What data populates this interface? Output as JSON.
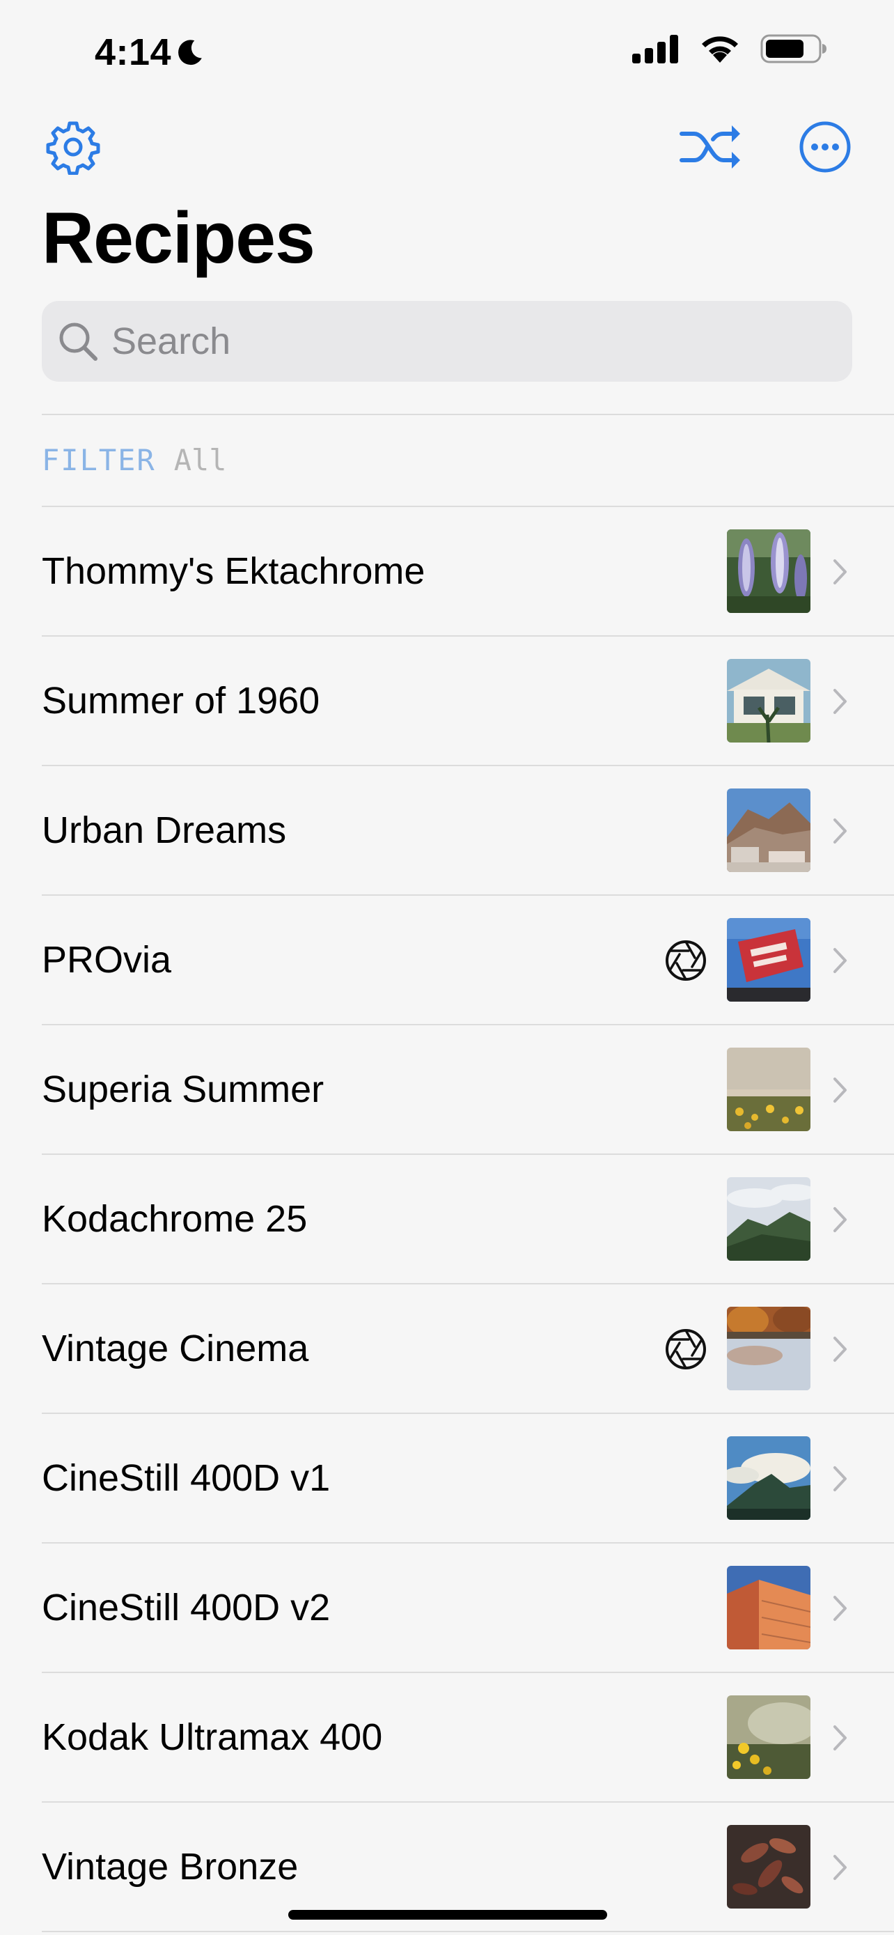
{
  "status_bar": {
    "time": "4:14",
    "icons": [
      "moon-icon",
      "cellular-signal-icon",
      "wifi-icon",
      "battery-icon"
    ]
  },
  "nav": {
    "left_icon": "gear-icon",
    "right_icons": [
      "shuffle-icon",
      "more-ellipsis-icon"
    ],
    "accent_color": "#2c7ce5"
  },
  "title": "Recipes",
  "search": {
    "placeholder": "Search"
  },
  "filter": {
    "label": "FILTER",
    "value": "All"
  },
  "recipes": [
    {
      "name": "Thommy's Ektachrome",
      "has_camera_icon": false,
      "thumbnail": "lupine-flowers"
    },
    {
      "name": "Summer of 1960",
      "has_camera_icon": false,
      "thumbnail": "house"
    },
    {
      "name": "Urban Dreams",
      "has_camera_icon": false,
      "thumbnail": "hillside-town"
    },
    {
      "name": "PROvia",
      "has_camera_icon": true,
      "thumbnail": "red-sign"
    },
    {
      "name": "Superia Summer",
      "has_camera_icon": false,
      "thumbnail": "yellow-flowers-field"
    },
    {
      "name": "Kodachrome 25",
      "has_camera_icon": false,
      "thumbnail": "green-hill"
    },
    {
      "name": "Vintage Cinema",
      "has_camera_icon": true,
      "thumbnail": "lake-reflection"
    },
    {
      "name": "CineStill 400D v1",
      "has_camera_icon": false,
      "thumbnail": "mountain-clouds"
    },
    {
      "name": "CineStill 400D v2",
      "has_camera_icon": false,
      "thumbnail": "orange-building"
    },
    {
      "name": "Kodak Ultramax 400",
      "has_camera_icon": false,
      "thumbnail": "yellow-flowers-blur"
    },
    {
      "name": "Vintage Bronze",
      "has_camera_icon": false,
      "thumbnail": "dark-leaves"
    }
  ]
}
